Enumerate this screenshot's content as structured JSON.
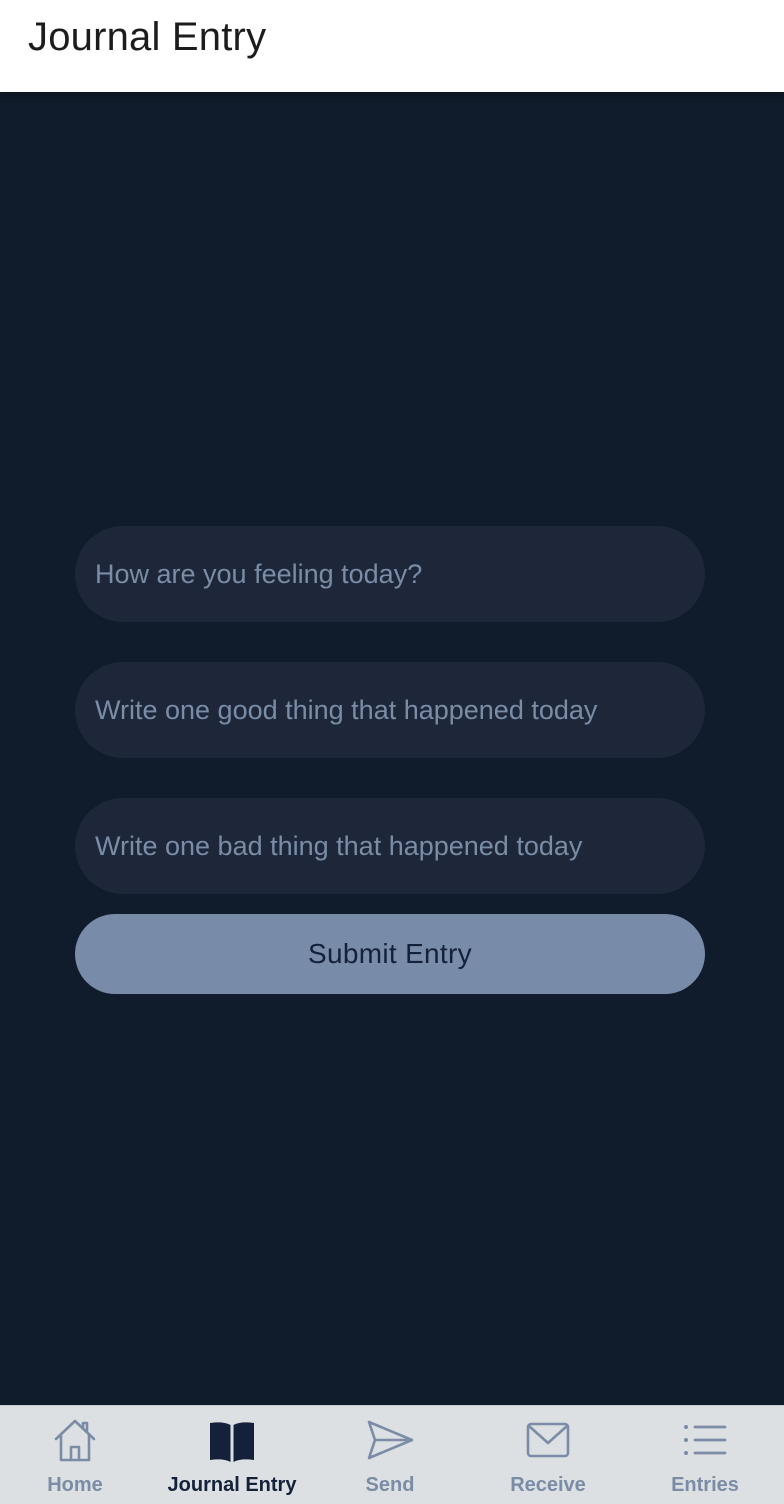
{
  "header": {
    "title": "Journal Entry"
  },
  "form": {
    "feeling_placeholder": "How are you feeling today?",
    "good_placeholder": "Write one good thing that happened today",
    "bad_placeholder": "Write one bad thing that happened today",
    "submit_label": "Submit Entry"
  },
  "tabbar": {
    "active_tab": "Journal Entry",
    "tabs": [
      {
        "label": "Home",
        "icon": "home-icon"
      },
      {
        "label": "Journal Entry",
        "icon": "book-icon"
      },
      {
        "label": "Send",
        "icon": "send-icon"
      },
      {
        "label": "Receive",
        "icon": "mail-icon"
      },
      {
        "label": "Entries",
        "icon": "list-icon"
      }
    ]
  },
  "colors": {
    "background": "#101b2b",
    "field_background": "#1d2739",
    "accent": "#788ba8",
    "tab_active": "#14213a",
    "tab_inactive": "#7a8ca6"
  }
}
